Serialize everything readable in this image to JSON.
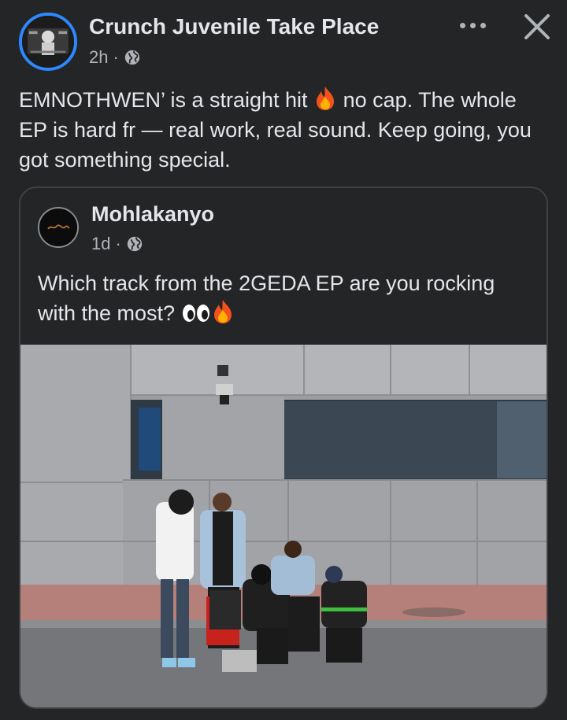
{
  "post": {
    "author": "Crunch Juvenile Take Place",
    "time": "2h",
    "separator": "·",
    "privacy_icon": "globe-icon",
    "text_before_fire": "EMNOTHWEN’ is a straight hit",
    "text_after_fire": " no cap. The whole EP is hard fr — real work, real sound. Keep going, you got something special."
  },
  "header_actions": {
    "more_icon": "more-horizontal-icon",
    "close_icon": "close-icon"
  },
  "shared_post": {
    "author": "Mohlakanyo",
    "time": "1d",
    "separator": "·",
    "privacy_icon": "globe-icon",
    "text": "Which track from the 2GEDA EP are you rocking with the most?"
  },
  "colors": {
    "background": "#242526",
    "text_primary": "#e4e6eb",
    "text_secondary": "#b0b3b8",
    "avatar_ring": "#2d88ff",
    "card_border": "#3e4042"
  }
}
